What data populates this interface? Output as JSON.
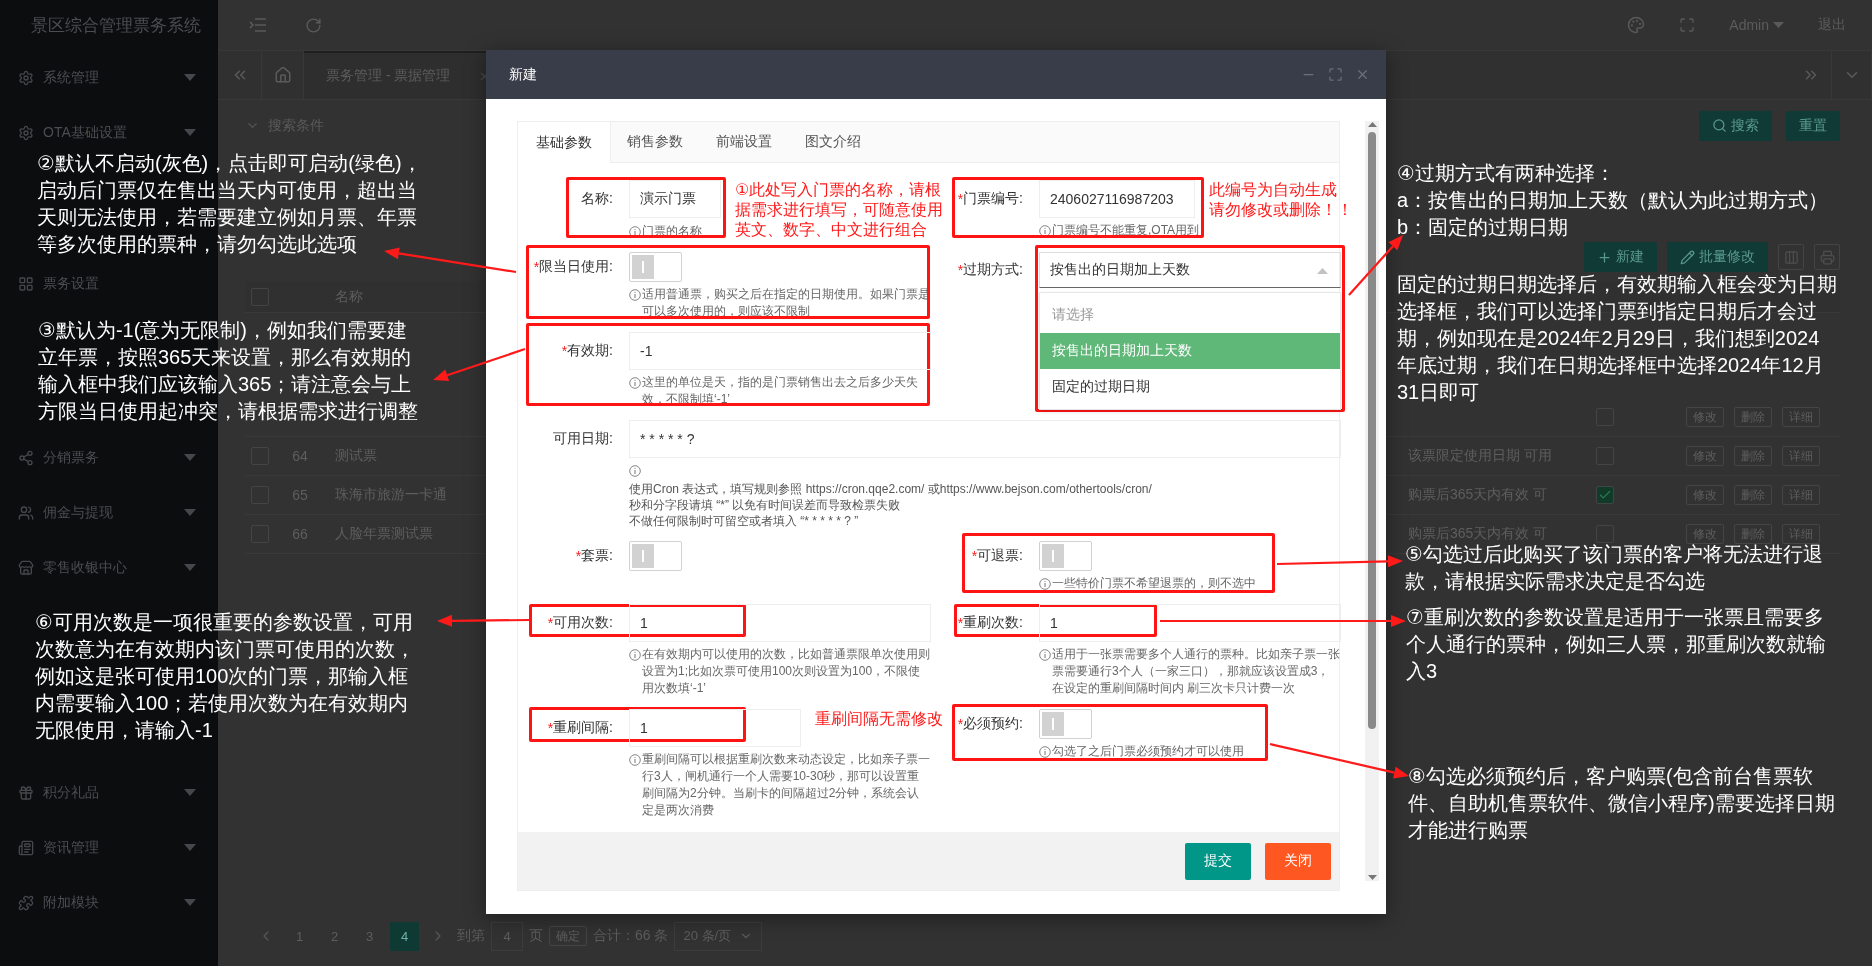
{
  "app": {
    "title": "景区综合管理票务系统"
  },
  "sidebar": {
    "groups": [
      {
        "items": [
          {
            "label": "系统管理",
            "kind": "group",
            "selected": false
          },
          {
            "label": "OTA基础设置",
            "kind": "group",
            "selected": false
          }
        ]
      },
      {
        "items": [
          {
            "label": "票务设置",
            "kind": "sub",
            "selected": false
          }
        ]
      },
      {
        "items": [
          {
            "label": "分销票务",
            "kind": "group",
            "selected": false
          },
          {
            "label": "佣金与提现",
            "kind": "group",
            "selected": false
          },
          {
            "label": "零售收银中心",
            "kind": "group",
            "selected": false
          }
        ]
      },
      {
        "items": [
          {
            "label": "积分礼品",
            "kind": "group",
            "selected": false
          },
          {
            "label": "资讯管理",
            "kind": "group",
            "selected": false
          },
          {
            "label": "附加模块",
            "kind": "group",
            "selected": false
          }
        ]
      }
    ]
  },
  "header": {
    "user": "Admin",
    "logout": "退出"
  },
  "page_tabs": [
    {
      "label": "票务管理 - 票据管理",
      "selected": true
    }
  ],
  "search": {
    "title": "搜索条件",
    "buttons": [
      {
        "label": "搜索",
        "kind": "search"
      },
      {
        "label": "重置",
        "kind": "plain"
      }
    ]
  },
  "toolbar": {
    "buttons": [
      {
        "label": "新建",
        "kind": "add"
      },
      {
        "label": "批量修改",
        "kind": "edit"
      }
    ]
  },
  "table": {
    "columns": [
      "名称"
    ],
    "all_selected": false,
    "rows": [
      {
        "checked": false,
        "actions": [
          "修改",
          "删除",
          "详细"
        ]
      },
      {
        "id": "64",
        "name": "测试票",
        "description": "该票限定使用日期 可用",
        "selected": false,
        "checked": false,
        "actions": [
          "修改",
          "删除",
          "详细"
        ]
      },
      {
        "id": "65",
        "name": "珠海市旅游一卡通",
        "description": "购票后365天内有效 可",
        "selected": false,
        "checked": true,
        "actions": [
          "修改",
          "删除",
          "详细"
        ]
      },
      {
        "id": "66",
        "name": "人脸年票测试票",
        "description": "购票后365天内有效 可",
        "selected": false,
        "checked": false,
        "actions": [
          "修改",
          "删除",
          "详细"
        ]
      }
    ]
  },
  "pagination": {
    "pages": [
      {
        "label": "1",
        "selected": false
      },
      {
        "label": "2",
        "selected": false
      },
      {
        "label": "3",
        "selected": false
      },
      {
        "label": "4",
        "selected": true
      }
    ],
    "goto_label": "到第",
    "goto_value": "4",
    "page_unit": "页",
    "confirm": "确定",
    "total": "合计：66 条",
    "page_size": "20 条/页"
  },
  "dialog": {
    "title": "新建",
    "tabs": [
      {
        "label": "基础参数",
        "selected": true
      },
      {
        "label": "销售参数",
        "selected": false
      },
      {
        "label": "前端设置",
        "selected": false
      },
      {
        "label": "图文介绍",
        "selected": false
      }
    ],
    "fields": [
      {
        "label": "名称:",
        "kind": "input",
        "value": "演示门票",
        "hint": "门票的名称",
        "note": [
          "①此处写入门票的名称，请根",
          "据需求进行填写，可随意使用",
          "英文、数字、中文进行组合"
        ]
      },
      {
        "label": "门票编号:",
        "required_mark": "*",
        "kind": "input",
        "value": "2406027116987203",
        "hint": "门票编号不能重复,OTA用到",
        "note": [
          "此编号为自动生成",
          "请勿修改或删除！！"
        ]
      },
      {
        "label": "限当日使用:",
        "required_mark": "*",
        "kind": "toggle",
        "on": false,
        "hint": "适用普通票，购买之后在指定的日期使用。如果门票是可以多次使用的，则应该不限制"
      },
      {
        "label": "过期方式:",
        "required_mark": "*",
        "kind": "select",
        "value": "按售出的日期加上天数",
        "expanded": true,
        "empty_option": "请选择",
        "options": [
          {
            "label": "按售出的日期加上天数",
            "selected": true
          },
          {
            "label": "固定的过期日期",
            "selected": false
          }
        ]
      },
      {
        "label": "有效期:",
        "required_mark": "*",
        "kind": "input",
        "value": "-1",
        "hint": "这里的单位是天，指的是门票销售出去之后多少天失效，不限制填‘-1’"
      },
      {
        "label": "可用日期:",
        "kind": "input",
        "wide": true,
        "value": "* * * * * ?",
        "hint": [
          "使用Cron 表达式，填写规则参照 https://cron.qqe2.com/ 或https://www.bejson.com/othertools/cron/",
          "秒和分字段请填 “*” 以免有时间误差而导致检票失败",
          "不做任何限制时可留空或者填入 “* * * * * ? ”"
        ]
      },
      {
        "label": "套票:",
        "required_mark": "*",
        "kind": "toggle",
        "on": false
      },
      {
        "label": "可退票:",
        "required_mark": "*",
        "kind": "toggle",
        "on": false,
        "hint": "一些特价门票不希望退票的，则不选中"
      },
      {
        "label": "可用次数:",
        "required_mark": "*",
        "kind": "input",
        "value": "1",
        "hint": "在有效期内可以使用的次数，比如普通票限单次使用则设置为1;比如次票可使用100次则设置为100，不限使用次数填‘-1’"
      },
      {
        "label": "重刷次数:",
        "required_mark": "*",
        "kind": "input",
        "value": "1",
        "hint": "适用于一张票需要多个人通行的票种。比如亲子票一张票需要通行3个人（一家三口），那就应该设置成3，在设定的重刷间隔时间内 刷三次卡只计费一次"
      },
      {
        "label": "重刷间隔:",
        "required_mark": "*",
        "kind": "input",
        "value": "1",
        "hint": "重刷间隔可以根据重刷次数来动态设定，比如亲子票一行3人，闸机通行一个人需要10-30秒，那可以设置重刷间隔为2分钟。当刷卡的间隔超过2分钟，系统会认定是两次消费",
        "note": [
          "重刷间隔无需修改"
        ]
      },
      {
        "label": "必须预约:",
        "required_mark": "*",
        "kind": "toggle",
        "on": false,
        "hint": "勾选了之后门票必须预约才可以使用"
      }
    ],
    "buttons": [
      {
        "label": "提交",
        "kind": "primary"
      },
      {
        "label": "关闭",
        "kind": "danger"
      }
    ]
  },
  "annotations": [
    {
      "lines": [
        "②默认不启动(灰色)，点击即可启动(绿色)，",
        "启动后门票仅在售出当天内可使用，超出当",
        "天则无法使用，若需要建立例如月票、年票",
        "等多次使用的票种，请勿勾选此选项"
      ]
    },
    {
      "lines": [
        "④过期方式有两种选择：",
        "a：按售出的日期加上天数（默认为此过期方式）",
        "b：固定的过期日期"
      ]
    },
    {
      "lines": [
        "固定的过期日期选择后，有效期输入框会变为日期",
        "选择框，我们可以选择门票到指定日期后才会过",
        "期，例如现在是2024年2月29日，我们想到2024",
        "年底过期，我们在日期选择框中选择2024年12月",
        "31日即可"
      ]
    },
    {
      "lines": [
        "③默认为-1(意为无限制)，例如我们需要建",
        "立年票，按照365天来设置，那么有效期的",
        "输入框中我们应该输入365；请注意会与上",
        "方限当日使用起冲突，请根据需求进行调整"
      ]
    },
    {
      "lines": [
        "⑤勾选过后此购买了该门票的客户将无法进行退",
        "款，请根据实际需求决定是否勾选"
      ]
    },
    {
      "lines": [
        "⑥可用次数是一项很重要的参数设置，可用",
        "次数意为在有效期内该门票可使用的次数，",
        "例如这是张可使用100次的门票，那输入框",
        "内需要输入100；若使用次数为在有效期内",
        "无限使用，请输入-1"
      ]
    },
    {
      "lines": [
        "⑦重刷次数的参数设置是适用于一张票且需要多",
        "个人通行的票种，例如三人票，那重刷次数就输",
        "入3"
      ]
    },
    {
      "lines": [
        "⑧勾选必须预约后，客户购票(包含前台售票软",
        "件、自助机售票软件、微信小程序)需要选择日期",
        "才能进行购票"
      ]
    }
  ]
}
